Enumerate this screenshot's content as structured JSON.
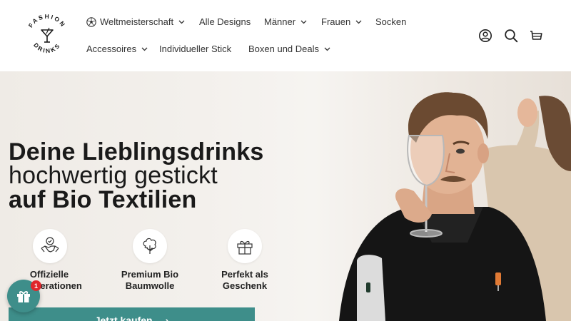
{
  "brand": {
    "logo_text": "FASHION DRINKS"
  },
  "nav": {
    "row1": [
      {
        "label": "Weltmeisterschaft",
        "icon": "soccer-ball-icon",
        "dropdown": true
      },
      {
        "label": "Alle Designs",
        "dropdown": false
      },
      {
        "label": "Männer",
        "dropdown": true
      },
      {
        "label": "Frauen",
        "dropdown": true
      },
      {
        "label": "Socken",
        "dropdown": false
      }
    ],
    "row2": [
      {
        "label": "Accessoires",
        "dropdown": true
      },
      {
        "label": "Individueller Stick",
        "dropdown": false
      },
      {
        "label": "Boxen und Deals",
        "dropdown": true
      }
    ]
  },
  "header_icons": [
    "account-icon",
    "search-icon",
    "cart-icon"
  ],
  "hero": {
    "line1": "Deine Lieblingsdrinks",
    "line2": "hochwertig gestickt",
    "line3": "auf Bio Textilien",
    "features": [
      {
        "label": "Offizielle Kooperationen",
        "icon": "handshake-icon"
      },
      {
        "label": "Premium Bio Baumwolle",
        "icon": "cotton-plant-icon"
      },
      {
        "label": "Perfekt als Geschenk",
        "icon": "gift-box-icon"
      }
    ],
    "cta_label": "Jetzt kaufen",
    "cta_arrow": "›"
  },
  "gift_widget": {
    "badge_count": "1"
  },
  "colors": {
    "accent": "#3e8e8a",
    "badge": "#e0262b",
    "text": "#1a1a1a"
  }
}
